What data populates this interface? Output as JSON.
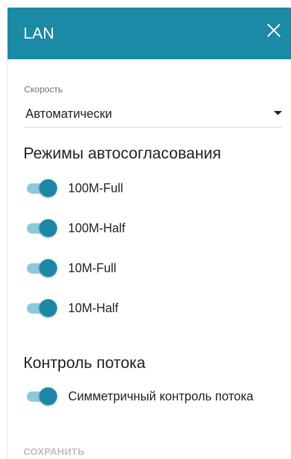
{
  "header": {
    "title": "LAN",
    "close_icon": "close-icon"
  },
  "speed": {
    "label": "Скорость",
    "value": "Автоматически"
  },
  "autonegotiation": {
    "title": "Режимы автосогласования",
    "modes": [
      {
        "label": "100M-Full",
        "enabled": true
      },
      {
        "label": "100M-Half",
        "enabled": true
      },
      {
        "label": "10M-Full",
        "enabled": true
      },
      {
        "label": "10M-Half",
        "enabled": true
      }
    ]
  },
  "flow_control": {
    "title": "Контроль потока",
    "toggle": {
      "label": "Симметричный контроль потока",
      "enabled": true
    }
  },
  "footer": {
    "save_label": "СОХРАНИТЬ"
  },
  "colors": {
    "accent": "#1a8aa6",
    "toggle_track": "#8fc9d8",
    "toggle_knob": "#1a88a5",
    "disabled_text": "#bdbdbd"
  }
}
